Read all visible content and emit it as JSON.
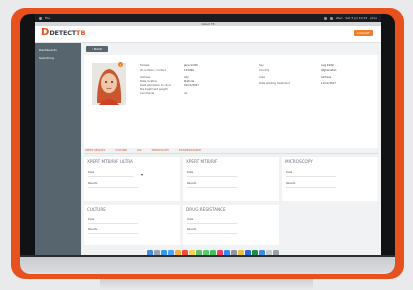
{
  "window": {
    "title": "Detect TB"
  },
  "menubar": {
    "left_items": [
      "",
      "File"
    ],
    "right_items": [
      "Wed",
      "Sat 3 Jul 10:15",
      "ptxx"
    ]
  },
  "header": {
    "logo": {
      "mark": "D",
      "name": "DETECT",
      "suffix": "TB"
    },
    "logout_label": "LOGOUT"
  },
  "sidebar": {
    "items": [
      "Dashboards",
      "Searching"
    ]
  },
  "main": {
    "back_label": "BACK",
    "badge_count": "1",
    "patient": {
      "left_labels": [
        "Female",
        "ID number / contact",
        "Address",
        "Date location",
        "Date admission to clinic",
        "Pre-treatment weight",
        "Comments"
      ],
      "left_values": [
        "Jane Smith",
        "123456",
        "city",
        "Pretoria",
        "01/11/2017",
        "",
        "no"
      ],
      "right_labels": [
        "Sex",
        "Country",
        "Area",
        "Date starting treatment"
      ],
      "right_values": [
        "Aug 1990",
        "Afghanistan",
        "address",
        "11/11/2017"
      ]
    },
    "tabs": [
      "XPERT RESULTS",
      "CULTURE",
      "LPA",
      "MICROSCOPY",
      "DST/RESISTANCE"
    ],
    "panels": [
      {
        "title": "XPERT MTB/RIF ULTRA",
        "rows": [
          "Date",
          "Results"
        ]
      },
      {
        "title": "XPERT MTB/RIF",
        "rows": [
          "Date",
          "Results"
        ]
      },
      {
        "title": "MICROSCOPY",
        "rows": [
          "Date",
          "Results"
        ]
      },
      {
        "title": "CULTURE",
        "rows": [
          "Date",
          "Results"
        ]
      },
      {
        "title": "DRUG RESISTANCE",
        "rows": [
          "Date",
          "Results"
        ]
      }
    ]
  },
  "colors": {
    "accent": "#e8501e",
    "sidebar": "#57656f",
    "button": "#f07d2a"
  },
  "dock_icons": [
    "finder-icon",
    "launchpad-icon",
    "safari-icon",
    "mail-icon",
    "photos-icon",
    "calendar-icon",
    "notes-icon",
    "maps-icon",
    "messages-icon",
    "facetime-icon",
    "music-icon",
    "appstore-icon",
    "settings-icon",
    "chrome-icon",
    "word-icon",
    "excel-icon",
    "finder2-icon",
    "files-icon",
    "trash-icon"
  ]
}
